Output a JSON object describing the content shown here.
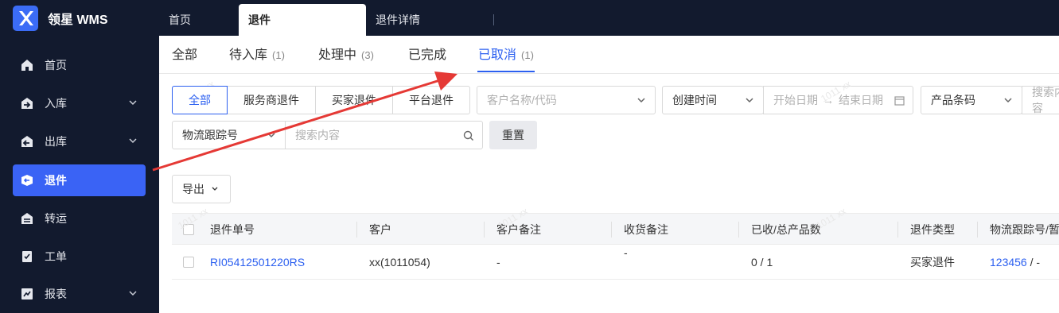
{
  "app": {
    "title": "领星 WMS"
  },
  "sidebar": {
    "items": [
      {
        "label": "首页",
        "icon": "home-icon",
        "expandable": false
      },
      {
        "label": "入库",
        "icon": "inbound-icon",
        "expandable": true
      },
      {
        "label": "出库",
        "icon": "outbound-icon",
        "expandable": true
      },
      {
        "label": "退件",
        "icon": "return-icon",
        "expandable": false,
        "active": true
      },
      {
        "label": "转运",
        "icon": "transfer-icon",
        "expandable": false
      },
      {
        "label": "工单",
        "icon": "workorder-icon",
        "expandable": false
      },
      {
        "label": "报表",
        "icon": "report-icon",
        "expandable": true
      }
    ]
  },
  "top_tabs": [
    "首页",
    "退件",
    "退件详情"
  ],
  "status_tabs": [
    {
      "label": "全部",
      "count": ""
    },
    {
      "label": "待入库",
      "count": "(1)"
    },
    {
      "label": "处理中",
      "count": "(3)"
    },
    {
      "label": "已完成",
      "count": ""
    },
    {
      "label": "已取消",
      "count": "(1)"
    }
  ],
  "filters": {
    "type_segments": [
      "全部",
      "服务商退件",
      "买家退件",
      "平台退件"
    ],
    "customer_placeholder": "客户名称/代码",
    "time_select": "创建时间",
    "start_date_placeholder": "开始日期",
    "end_date_placeholder": "结束日期",
    "product_select": "产品条码",
    "product_search_placeholder": "搜索内容",
    "tracking_select": "物流跟踪号",
    "tracking_search_placeholder": "搜索内容",
    "reset_label": "重置"
  },
  "toolbar": {
    "export_label": "导出"
  },
  "table": {
    "columns": [
      "退件单号",
      "客户",
      "客户备注",
      "收货备注",
      "已收/总产品数",
      "退件类型",
      "物流跟踪号/暂"
    ],
    "rows": [
      {
        "return_no": "RI05412501220RS",
        "customer": "xx(1011054)",
        "customer_note": "-",
        "receive_note": "-",
        "received_total": "0 / 1",
        "return_type": "买家退件",
        "tracking": "123456",
        "tracking_suffix": " / -"
      }
    ]
  },
  "watermark": "1011 xx",
  "colors": {
    "sidebar_bg": "#121a2e",
    "accent": "#2b5ff0",
    "annotation_arrow": "#e53935"
  }
}
